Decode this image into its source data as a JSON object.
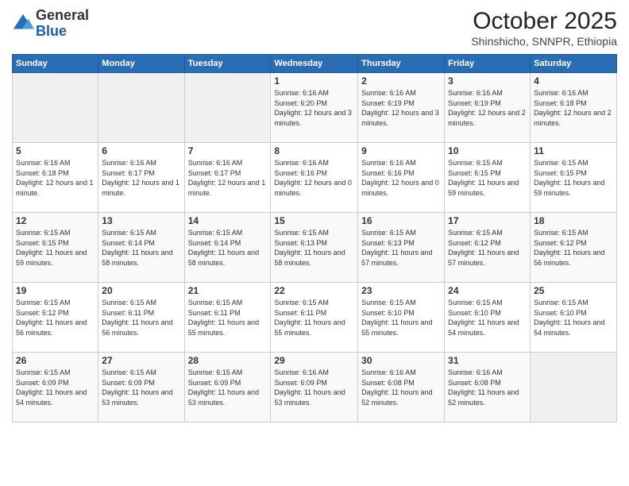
{
  "logo": {
    "general": "General",
    "blue": "Blue"
  },
  "header": {
    "month": "October 2025",
    "location": "Shinshicho, SNNPR, Ethiopia"
  },
  "days_header": [
    "Sunday",
    "Monday",
    "Tuesday",
    "Wednesday",
    "Thursday",
    "Friday",
    "Saturday"
  ],
  "weeks": [
    [
      {
        "day": "",
        "info": ""
      },
      {
        "day": "",
        "info": ""
      },
      {
        "day": "",
        "info": ""
      },
      {
        "day": "1",
        "info": "Sunrise: 6:16 AM\nSunset: 6:20 PM\nDaylight: 12 hours and 3 minutes."
      },
      {
        "day": "2",
        "info": "Sunrise: 6:16 AM\nSunset: 6:19 PM\nDaylight: 12 hours and 3 minutes."
      },
      {
        "day": "3",
        "info": "Sunrise: 6:16 AM\nSunset: 6:19 PM\nDaylight: 12 hours and 2 minutes."
      },
      {
        "day": "4",
        "info": "Sunrise: 6:16 AM\nSunset: 6:18 PM\nDaylight: 12 hours and 2 minutes."
      }
    ],
    [
      {
        "day": "5",
        "info": "Sunrise: 6:16 AM\nSunset: 6:18 PM\nDaylight: 12 hours and 1 minute."
      },
      {
        "day": "6",
        "info": "Sunrise: 6:16 AM\nSunset: 6:17 PM\nDaylight: 12 hours and 1 minute."
      },
      {
        "day": "7",
        "info": "Sunrise: 6:16 AM\nSunset: 6:17 PM\nDaylight: 12 hours and 1 minute."
      },
      {
        "day": "8",
        "info": "Sunrise: 6:16 AM\nSunset: 6:16 PM\nDaylight: 12 hours and 0 minutes."
      },
      {
        "day": "9",
        "info": "Sunrise: 6:16 AM\nSunset: 6:16 PM\nDaylight: 12 hours and 0 minutes."
      },
      {
        "day": "10",
        "info": "Sunrise: 6:15 AM\nSunset: 6:15 PM\nDaylight: 11 hours and 59 minutes."
      },
      {
        "day": "11",
        "info": "Sunrise: 6:15 AM\nSunset: 6:15 PM\nDaylight: 11 hours and 59 minutes."
      }
    ],
    [
      {
        "day": "12",
        "info": "Sunrise: 6:15 AM\nSunset: 6:15 PM\nDaylight: 11 hours and 59 minutes."
      },
      {
        "day": "13",
        "info": "Sunrise: 6:15 AM\nSunset: 6:14 PM\nDaylight: 11 hours and 58 minutes."
      },
      {
        "day": "14",
        "info": "Sunrise: 6:15 AM\nSunset: 6:14 PM\nDaylight: 11 hours and 58 minutes."
      },
      {
        "day": "15",
        "info": "Sunrise: 6:15 AM\nSunset: 6:13 PM\nDaylight: 11 hours and 58 minutes."
      },
      {
        "day": "16",
        "info": "Sunrise: 6:15 AM\nSunset: 6:13 PM\nDaylight: 11 hours and 57 minutes."
      },
      {
        "day": "17",
        "info": "Sunrise: 6:15 AM\nSunset: 6:12 PM\nDaylight: 11 hours and 57 minutes."
      },
      {
        "day": "18",
        "info": "Sunrise: 6:15 AM\nSunset: 6:12 PM\nDaylight: 11 hours and 56 minutes."
      }
    ],
    [
      {
        "day": "19",
        "info": "Sunrise: 6:15 AM\nSunset: 6:12 PM\nDaylight: 11 hours and 56 minutes."
      },
      {
        "day": "20",
        "info": "Sunrise: 6:15 AM\nSunset: 6:11 PM\nDaylight: 11 hours and 56 minutes."
      },
      {
        "day": "21",
        "info": "Sunrise: 6:15 AM\nSunset: 6:11 PM\nDaylight: 11 hours and 55 minutes."
      },
      {
        "day": "22",
        "info": "Sunrise: 6:15 AM\nSunset: 6:11 PM\nDaylight: 11 hours and 55 minutes."
      },
      {
        "day": "23",
        "info": "Sunrise: 6:15 AM\nSunset: 6:10 PM\nDaylight: 11 hours and 55 minutes."
      },
      {
        "day": "24",
        "info": "Sunrise: 6:15 AM\nSunset: 6:10 PM\nDaylight: 11 hours and 54 minutes."
      },
      {
        "day": "25",
        "info": "Sunrise: 6:15 AM\nSunset: 6:10 PM\nDaylight: 11 hours and 54 minutes."
      }
    ],
    [
      {
        "day": "26",
        "info": "Sunrise: 6:15 AM\nSunset: 6:09 PM\nDaylight: 11 hours and 54 minutes."
      },
      {
        "day": "27",
        "info": "Sunrise: 6:15 AM\nSunset: 6:09 PM\nDaylight: 11 hours and 53 minutes."
      },
      {
        "day": "28",
        "info": "Sunrise: 6:15 AM\nSunset: 6:09 PM\nDaylight: 11 hours and 53 minutes."
      },
      {
        "day": "29",
        "info": "Sunrise: 6:16 AM\nSunset: 6:09 PM\nDaylight: 11 hours and 53 minutes."
      },
      {
        "day": "30",
        "info": "Sunrise: 6:16 AM\nSunset: 6:08 PM\nDaylight: 11 hours and 52 minutes."
      },
      {
        "day": "31",
        "info": "Sunrise: 6:16 AM\nSunset: 6:08 PM\nDaylight: 11 hours and 52 minutes."
      },
      {
        "day": "",
        "info": ""
      }
    ]
  ]
}
